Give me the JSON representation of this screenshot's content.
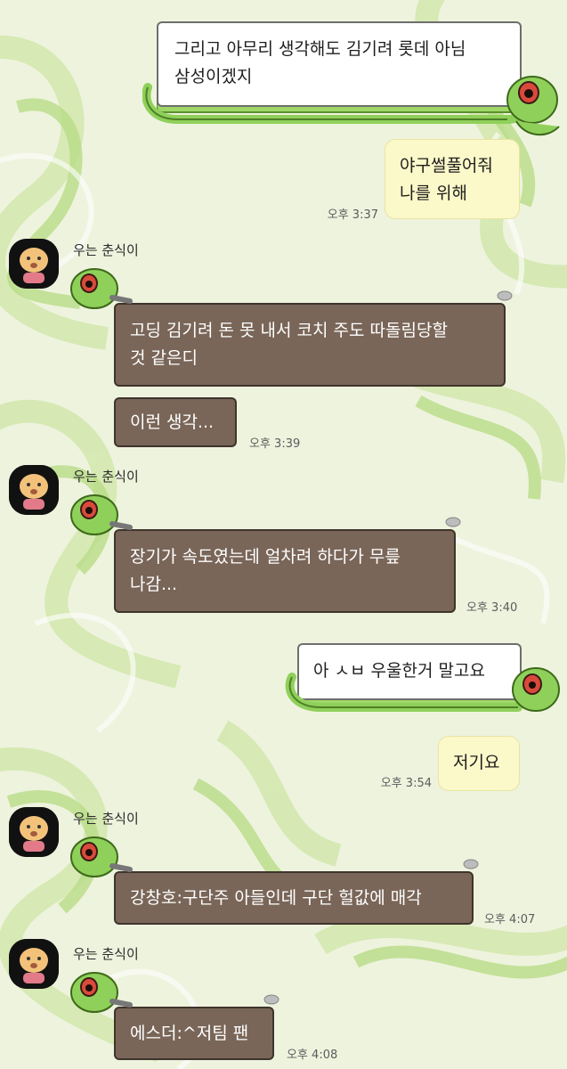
{
  "colors": {
    "background": "#eef3de",
    "swirl_light": "#d7ebb3",
    "swirl_mid": "#bfe08e",
    "bubble_brown": "#796658",
    "bubble_yellow": "#fbf8c9",
    "slime_green": "#8fd05a"
  },
  "messages": [
    {
      "id": "m1",
      "direction": "outgoing",
      "style": "slime-frame",
      "lines": "그리고 아무리 생각해도 김기려 롯데 아님\n삼성이겠지",
      "time": ""
    },
    {
      "id": "m2",
      "direction": "outgoing",
      "style": "yellow",
      "lines": "야구썰풀어줘\n나를 위해",
      "time": "오후 3:37"
    },
    {
      "id": "m3",
      "direction": "incoming",
      "sender": "우는 춘식이",
      "lines": "고딩 김기려 돈 못 내서 코치 주도 따돌림당할\n것 같은디",
      "time": ""
    },
    {
      "id": "m4",
      "direction": "incoming",
      "lines": "이런 생각...",
      "time": "오후 3:39"
    },
    {
      "id": "m5",
      "direction": "incoming",
      "sender": "우는 춘식이",
      "lines": "장기가 속도였는데 얼차려 하다가 무릎\n나감...",
      "time": "오후 3:40"
    },
    {
      "id": "m6",
      "direction": "outgoing",
      "style": "slime-frame",
      "lines": "아 ㅅㅂ 우울한거 말고요",
      "time": ""
    },
    {
      "id": "m7",
      "direction": "outgoing",
      "style": "yellow",
      "lines": "저기요",
      "time": "오후 3:54"
    },
    {
      "id": "m8",
      "direction": "incoming",
      "sender": "우는 춘식이",
      "lines": "강창호:구단주 아들인데 구단 헐값에 매각",
      "time": "오후 4:07"
    },
    {
      "id": "m9",
      "direction": "incoming",
      "sender": "우는 춘식이",
      "lines": "에스더:^저팀 팬",
      "time": "오후 4:08"
    }
  ],
  "icons": {
    "avatar": "crying-chunsik-avatar",
    "slime": "green-slime-sticker"
  }
}
